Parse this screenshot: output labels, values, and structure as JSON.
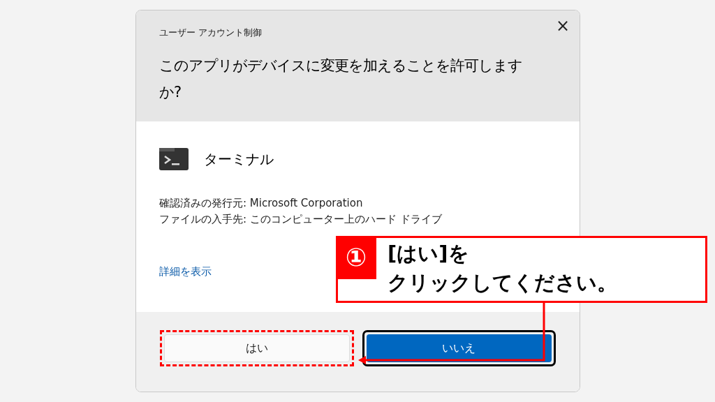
{
  "window": {
    "title": "ユーザー アカウント制御",
    "close": "×"
  },
  "question": "このアプリがデバイスに変更を加えることを許可しますか?",
  "app": {
    "name": "ターミナル"
  },
  "details": [
    "確認済みの発行元: Microsoft Corporation",
    "ファイルの入手先: このコンピューター上のハード ドライブ"
  ],
  "more_link": "詳細を表示",
  "buttons": [
    {
      "label": "はい",
      "kind": "secondary",
      "highlighted": true
    },
    {
      "label": "いいえ",
      "kind": "primary",
      "highlighted": false
    }
  ],
  "callout": {
    "number": "①",
    "lines": [
      "[はい]を",
      "クリックしてください。"
    ]
  }
}
